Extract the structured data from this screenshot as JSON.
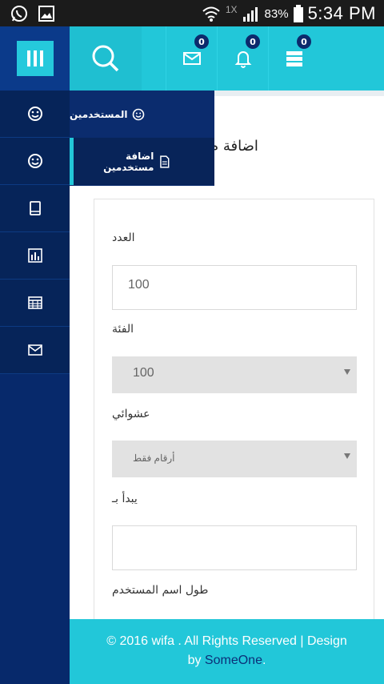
{
  "status_bar": {
    "network": "1X",
    "battery": "83%",
    "time": "5:34 PM"
  },
  "header": {
    "badges": {
      "messages": "0",
      "notifications": "0",
      "servers": "0"
    }
  },
  "dropdown": {
    "items": [
      {
        "label": "المستخدمين"
      },
      {
        "label": "اضافة مستخدمين"
      }
    ]
  },
  "page": {
    "title": "اضافة م"
  },
  "form": {
    "count_label": "العدد",
    "count_value": "100",
    "category_label": "الفئة",
    "category_value": "100",
    "random_label": "عشوائي",
    "random_value": "أرقام فقط",
    "starts_with_label": "يبدأ بـ",
    "starts_with_value": "",
    "username_length_label": "طول اسم المستخدم"
  },
  "footer": {
    "text": "© 2016 wifa . All Rights Reserved | Design",
    "by": "by",
    "link": "SomeOne",
    "end": "."
  },
  "colors": {
    "accent": "#22c7d9",
    "sidebar": "#07296b",
    "navy": "#0b2c6e"
  }
}
